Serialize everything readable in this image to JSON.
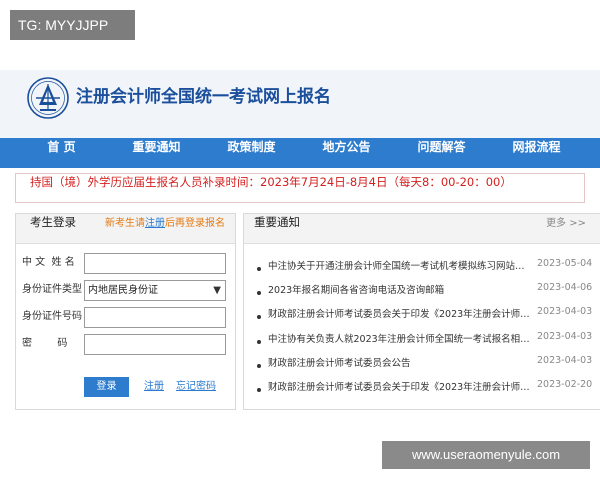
{
  "overlay": {
    "tag": "TG: MYYJJPP"
  },
  "header": {
    "site_title": "注册会计师全国统一考试网上报名"
  },
  "nav": {
    "items": [
      {
        "label": "首 页"
      },
      {
        "label": "重要通知"
      },
      {
        "label": "政策制度"
      },
      {
        "label": "地方公告"
      },
      {
        "label": "问题解答"
      },
      {
        "label": "网报流程"
      }
    ]
  },
  "notice": {
    "text": "持国（境）外学历应届生报名人员补录时间：2023年7月24日-8月4日（每天8：00-20：00）"
  },
  "login": {
    "title": "考生登录",
    "hint_prefix": "新考生请",
    "hint_link": "注册",
    "hint_suffix": "后再登录报名",
    "fields": {
      "name_label": "中 文  姓 名",
      "id_type_label": "身份证件类型",
      "id_type_value": "内地居民身份证",
      "id_number_label": "身份证件号码",
      "password_label": "密        码"
    },
    "login_button": "登录",
    "register_link": "注册",
    "forgot_link": "忘记密码"
  },
  "news": {
    "title": "重要通知",
    "more": "更多 >>",
    "items": [
      {
        "text": "中注协关于开通注册会计师全国统一考试机考模拟练习网站的公…",
        "date": "2023-05-04"
      },
      {
        "text": "2023年报名期间各省咨询电话及咨询邮箱",
        "date": "2023-04-06"
      },
      {
        "text": "财政部注册会计师考试委员会关于印发《2023年注册会计师…",
        "date": "2023-04-03"
      },
      {
        "text": "中注协有关负责人就2023年注册会计师全国统一考试报名相…",
        "date": "2023-04-03"
      },
      {
        "text": "财政部注册会计师考试委员会公告",
        "date": "2023-04-03"
      },
      {
        "text": "财政部注册会计师考试委员会关于印发《2023年注册会计师…",
        "date": "2023-02-20"
      }
    ]
  },
  "footer_overlay": {
    "text": "www.useraomenyule.com"
  },
  "colors": {
    "nav_blue": "#2e7ccd",
    "title_blue": "#1b4f9c",
    "notice_red": "#d4201f",
    "hint_orange": "#e57a12"
  }
}
